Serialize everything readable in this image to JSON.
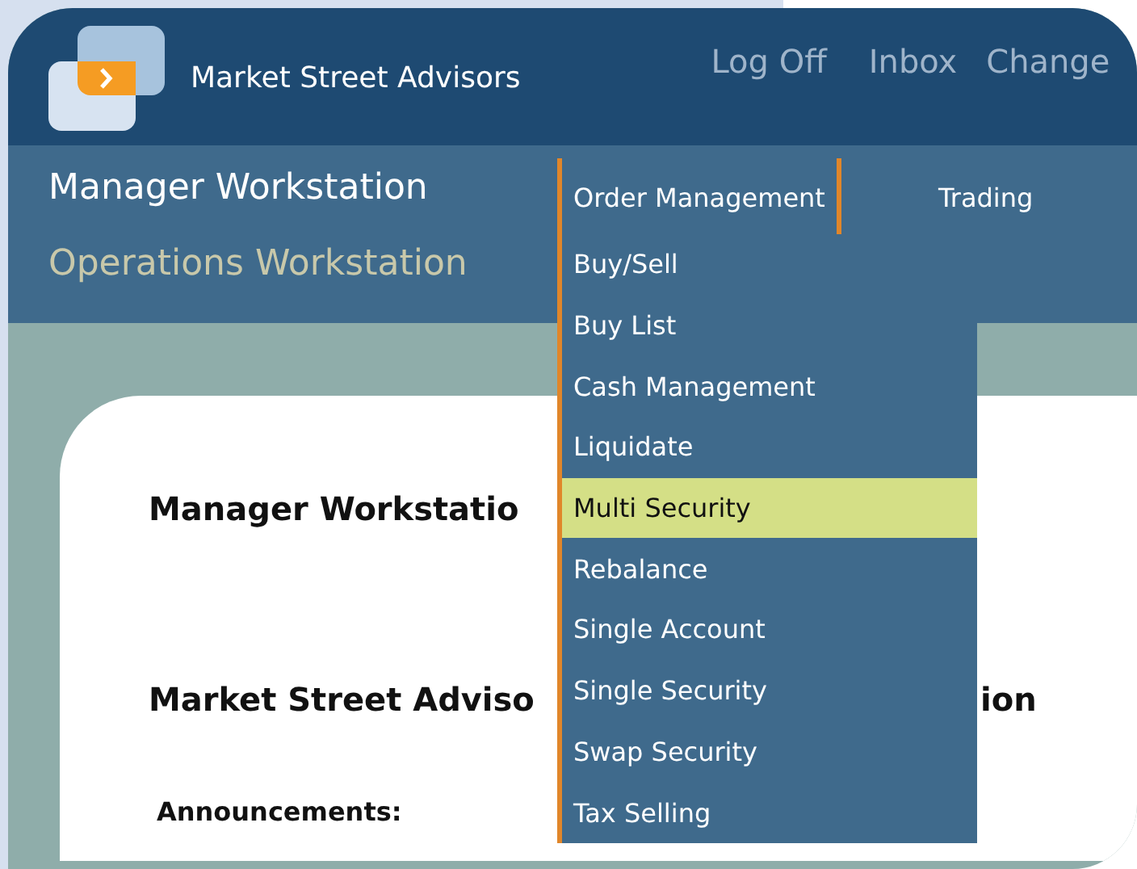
{
  "header": {
    "brand": "Market Street Advisors",
    "links": [
      "Log Off",
      "Inbox",
      "Change"
    ]
  },
  "workstations": [
    {
      "label": "Manager Workstation",
      "selected": true
    },
    {
      "label": "Operations Workstation",
      "selected": false
    }
  ],
  "menu_bar": [
    {
      "label": "Order Management",
      "selected": true
    },
    {
      "label": "Trading",
      "selected": false
    }
  ],
  "dropdown": [
    {
      "label": "Buy/Sell",
      "selected": false
    },
    {
      "label": "Buy List",
      "selected": false
    },
    {
      "label": "Cash Management",
      "selected": false
    },
    {
      "label": "Liquidate",
      "selected": false
    },
    {
      "label": "Multi Security",
      "selected": true
    },
    {
      "label": "Rebalance",
      "selected": false
    },
    {
      "label": "Single Account",
      "selected": false
    },
    {
      "label": "Single Security",
      "selected": false
    },
    {
      "label": "Swap Security",
      "selected": false
    },
    {
      "label": "Tax Selling",
      "selected": false
    }
  ],
  "content": {
    "title": "Manager Workstatio",
    "subtitle_left": "Market Street Adviso",
    "subtitle_right": "ion",
    "announcements_label": "Announcements:"
  }
}
